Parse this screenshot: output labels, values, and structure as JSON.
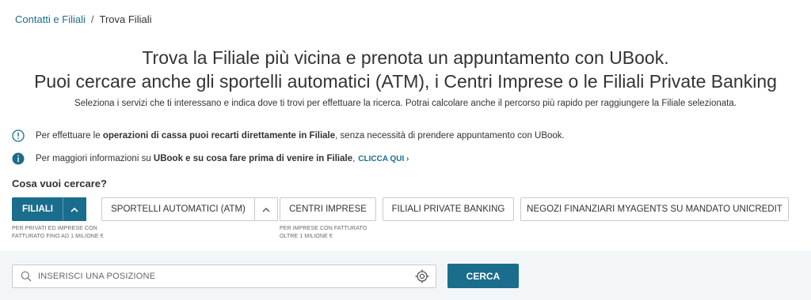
{
  "breadcrumb": {
    "parent": "Contatti e Filiali",
    "separator": "/",
    "current": "Trova Filiali"
  },
  "hero": {
    "line1": "Trova la Filiale più vicina e prenota un appuntamento con UBook.",
    "line2": "Puoi cercare anche gli sportelli automatici (ATM), i Centri Imprese o le Filiali Private Banking",
    "subtitle": "Seleziona i servizi che ti interessano e indica dove ti trovi per effettuare la ricerca. Potrai calcolare anche il percorso più rapido per raggiungere la Filiale selezionata."
  },
  "info1": {
    "icon": "info-outline-icon",
    "pre": "Per effettuare le ",
    "bold": "operazioni di cassa puoi recarti direttamente in Filiale",
    "post": ", senza necessità di prendere appuntamento con UBook."
  },
  "info2": {
    "icon": "info-filled-icon",
    "pre": "Per maggiori informazioni su ",
    "bold": "UBook e su cosa fare prima di venire in Filiale",
    "post": ",",
    "link": "CLICCA QUI ›"
  },
  "question": "Cosa vuoi cercare?",
  "options": {
    "filiali": {
      "label": "FILIALI",
      "note1": "PER PRIVATI ED IMPRESE CON",
      "note2": "FATTURATO FINO AD 1 MILIONE €",
      "selected": true
    },
    "atm": {
      "label": "SPORTELLI AUTOMATICI (ATM)"
    },
    "centri": {
      "label": "CENTRI IMPRESE",
      "note1": "PER IMPRESE CON FATTURATO",
      "note2": "OLTRE 1 MILIONE €"
    },
    "private": {
      "label": "FILIALI PRIVATE BANKING"
    },
    "negozi": {
      "label": "NEGOZI FINANZIARI MYAGENTS SU MANDATO UNICREDIT"
    }
  },
  "search": {
    "placeholder": "INSERISCI UNA POSIZIONE",
    "value": "",
    "button": "CERCA"
  },
  "colors": {
    "primary": "#1a6d8c",
    "searchBand": "#f3f6f8"
  }
}
